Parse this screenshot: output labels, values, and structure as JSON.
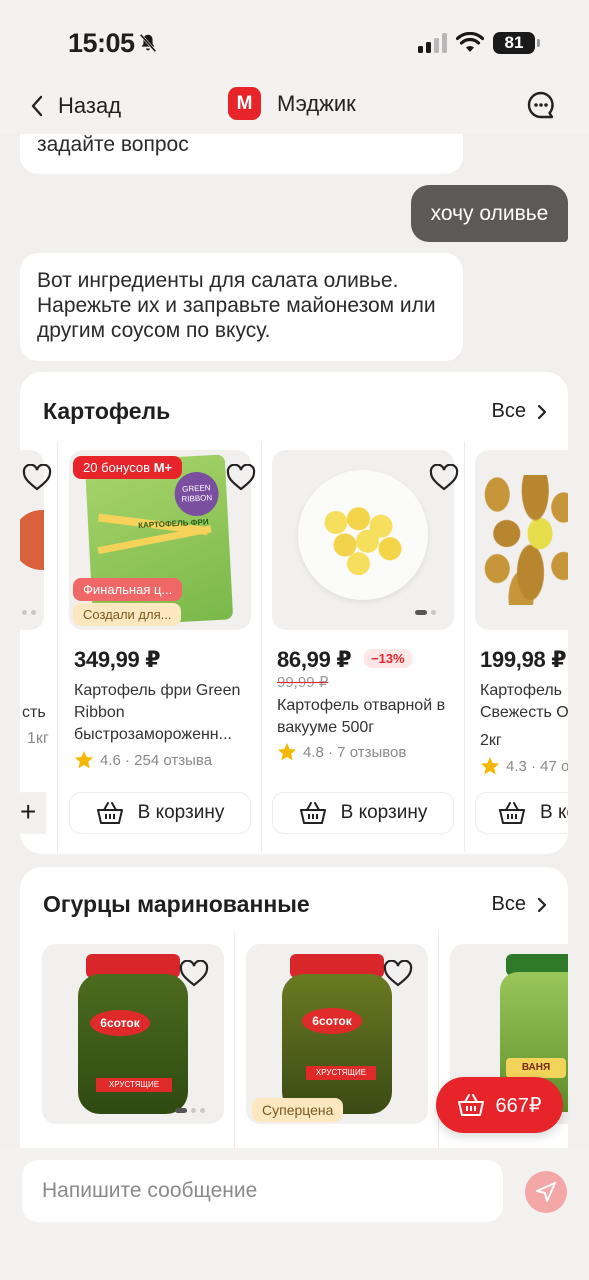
{
  "status_bar": {
    "time": "15:05",
    "battery": "81"
  },
  "header": {
    "back_label": "Назад",
    "logo_letter": "М",
    "title": "Мэджик"
  },
  "chat": {
    "prev_message_tail": "задайте вопрос",
    "user_message": "хочу оливье",
    "bot_reply": "Вот ингредиенты для салата оливье. Нарежьте их и заправьте майонезом или другим соусом по вкусу."
  },
  "section_potato": {
    "title": "Картофель",
    "all_label": "Все",
    "partial_left": {
      "name_tail": "сть",
      "weight_tail": "1кг"
    },
    "cards": [
      {
        "price": "349,99 ₽",
        "name": "Картофель фри Green Ribbon быстрозамороженн...",
        "rating": "4.6 · 254 отзыва",
        "cart_label": "В корзину",
        "badge_bonus": "20 бонусов",
        "badge_bonus_logo": "М+",
        "badge_final": "Финальная ц...",
        "badge_created": "Создали для...",
        "pack_brand": "GREEN RIBBON",
        "pack_text": "КАРТОФЕЛЬ ФРИ"
      },
      {
        "price": "86,99 ₽",
        "old_price": "99,99 ₽",
        "discount": "−13%",
        "name": "Картофель отварной в вакууме 500г",
        "rating": "4.8 · 7 отзывов",
        "cart_label": "В корзину"
      },
      {
        "price": "199,98 ₽",
        "name": "Картофель Свежесть О...",
        "weight": "2кг",
        "rating": "4.3 · 47 о...",
        "cart_label": "В ко..."
      }
    ]
  },
  "section_cucumber": {
    "title": "Огурцы маринованные",
    "all_label": "Все",
    "cards": [
      {
        "jar_brand": "6соток",
        "jar_label": "ХРУСТЯЩИЕ"
      },
      {
        "jar_brand": "6соток",
        "jar_label": "ХРУСТЯЩИЕ",
        "badge": "Суперцена"
      },
      {
        "jar_brand": "ВАНЯ"
      }
    ]
  },
  "floating_cart": {
    "total": "667₽"
  },
  "input": {
    "placeholder": "Напишите сообщение"
  },
  "colors": {
    "brand_red": "#e8242b",
    "user_bubble": "#5b5a57",
    "star": "#f5b800"
  }
}
